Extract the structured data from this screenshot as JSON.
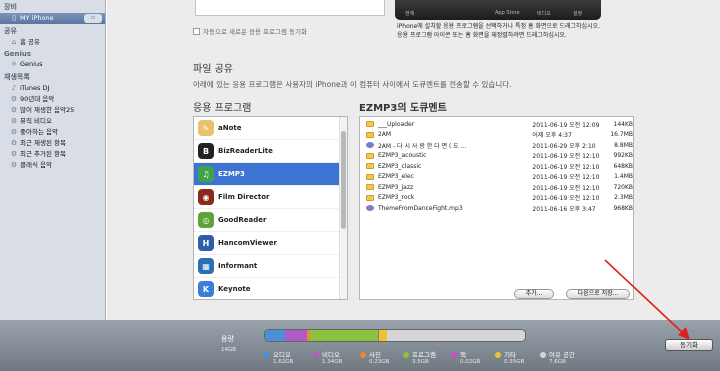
{
  "sidebar": {
    "devices_header": "장비",
    "device": {
      "label": "MY iPhone"
    },
    "shared_header": "공유",
    "home_share": "홈 공유",
    "genius_header": "Genius",
    "genius": "Genius",
    "playlists_header": "재생목록",
    "playlists": [
      "iTunes DJ",
      "90년대 음악",
      "많이 재생한 음악25",
      "뮤직 비디오",
      "좋아하는 음악",
      "최근 재생된 항목",
      "최근 추가된 항목",
      "클래식 음악"
    ]
  },
  "main": {
    "sync_checkbox_label": "자동으로 새로운 응용 프로그램 동기화",
    "preview_labels": [
      "현재",
      "App Store",
      "비디오",
      "설정"
    ],
    "info_line1": "iPhone에 설치할 응용 프로그램을 선택하거나 특정 홈 화면으로 드래그하십시오.",
    "info_line2": "응용 프로그램 아이콘 또는 홈 화면을 재정렬하려면 드래그하십시오.",
    "file_sharing_title": "파일 공유",
    "file_sharing_desc": "아래에 있는 응용 프로그램은 사용자의 iPhone과 이 컴퓨터 사이에서 도큐멘트를 전송할 수 있습니다.",
    "apps_title": "응용 프로그램",
    "docs_title": "EZMP3의 도큐멘트",
    "add_button": "추가...",
    "save_as_button": "다음으로 저장..."
  },
  "apps": [
    {
      "name": "aNote",
      "color": "#e8c36a",
      "icon": "note-icon"
    },
    {
      "name": "BizReaderLite",
      "color": "#222222",
      "icon": "reader-icon"
    },
    {
      "name": "EZMP3",
      "color": "#3fa24a",
      "icon": "music-icon",
      "selected": true
    },
    {
      "name": "Film Director",
      "color": "#8a2a1a",
      "icon": "film-icon"
    },
    {
      "name": "GoodReader",
      "color": "#5fa33a",
      "icon": "eye-icon"
    },
    {
      "name": "HancomViewer",
      "color": "#2f5ea8",
      "icon": "viewer-icon"
    },
    {
      "name": "Informant",
      "color": "#2b6fb8",
      "icon": "calendar-icon"
    },
    {
      "name": "Keynote",
      "color": "#3b7fd8",
      "icon": "keynote-icon"
    }
  ],
  "documents": [
    {
      "name": "___Uploader",
      "date": "2011-06-19 오전 12:09",
      "size": "144KB",
      "type": "folder"
    },
    {
      "name": "2AM",
      "date": "어제 오후 4:37",
      "size": "16.7MB",
      "type": "folder"
    },
    {
      "name": "2AM - 다 시  사 랑 한 다 면 ( 도 ...",
      "date": "2011-06-29 오후 2:10",
      "size": "8.8MB",
      "type": "file"
    },
    {
      "name": "EZMP3_acoustic",
      "date": "2011-06-19 오전 12:10",
      "size": "992KB",
      "type": "folder"
    },
    {
      "name": "EZMP3_classic",
      "date": "2011-06-19 오전 12:10",
      "size": "648KB",
      "type": "folder"
    },
    {
      "name": "EZMP3_elec",
      "date": "2011-06-19 오전 12:10",
      "size": "1.4MB",
      "type": "folder"
    },
    {
      "name": "EZMP3_jazz",
      "date": "2011-06-19 오전 12:10",
      "size": "720KB",
      "type": "folder"
    },
    {
      "name": "EZMP3_rock",
      "date": "2011-06-19 오전 12:10",
      "size": "2.3MB",
      "type": "folder"
    },
    {
      "name": "ThemeFromDanceFight.mp3",
      "date": "2011-06-16 오후 3:47",
      "size": "968KB",
      "type": "file"
    }
  ],
  "capacity": {
    "label": "용량",
    "total": "14GB",
    "segments": [
      {
        "name": "오디오",
        "size": "1.62GB",
        "color": "#4a8fd8",
        "fraction": 0.075
      },
      {
        "name": "비디오",
        "size": "1.34GB",
        "color": "#b05ac8",
        "fraction": 0.085
      },
      {
        "name": "사진",
        "size": "0.23GB",
        "color": "#e88a30",
        "fraction": 0.015
      },
      {
        "name": "프로그램",
        "size": "3.5GB",
        "color": "#8ec23a",
        "fraction": 0.26
      },
      {
        "name": "책",
        "size": "0.02GB",
        "color": "#c84fc8",
        "fraction": 0.005
      },
      {
        "name": "기타",
        "size": "0.35GB",
        "color": "#e8c828",
        "fraction": 0.03
      },
      {
        "name": "여유 공간",
        "size": "7.6GB",
        "color": "#d6d6d6",
        "fraction": 0.53
      }
    ]
  },
  "sync_button": "동기화"
}
